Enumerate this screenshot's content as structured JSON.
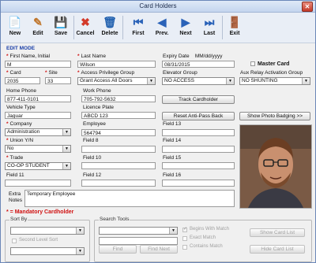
{
  "window": {
    "title": "Card Holders",
    "close_glyph": "✕"
  },
  "toolbar": [
    {
      "key": "new",
      "label": "New",
      "icon": "new-file-icon",
      "glyph": "📄",
      "color": "#2d6fb5"
    },
    {
      "key": "edit",
      "label": "Edit",
      "icon": "pencil-icon",
      "glyph": "✎",
      "color": "#c0762c"
    },
    {
      "key": "save",
      "label": "Save",
      "icon": "floppy-disk-icon",
      "glyph": "💾",
      "color": "#2f3f5f"
    },
    {
      "key": "cancel",
      "label": "Cancel",
      "icon": "cancel-icon",
      "glyph": "✖",
      "color": "#d33a2a"
    },
    {
      "key": "delete",
      "label": "Delete",
      "icon": "delete-icon",
      "glyph": "🗑",
      "color": "#1f5fae"
    },
    {
      "key": "first",
      "label": "First",
      "icon": "first-record-icon",
      "glyph": "⏮",
      "color": "#2a62b8"
    },
    {
      "key": "prev",
      "label": "Prev.",
      "icon": "previous-record-icon",
      "glyph": "◀",
      "color": "#2a62b8"
    },
    {
      "key": "next",
      "label": "Next",
      "icon": "next-record-icon",
      "glyph": "▶",
      "color": "#2a62b8"
    },
    {
      "key": "last",
      "label": "Last",
      "icon": "last-record-icon",
      "glyph": "⏭",
      "color": "#2a62b8"
    },
    {
      "key": "exit",
      "label": "Exit",
      "icon": "exit-door-icon",
      "glyph": "🚪",
      "color": "#3a8a2e"
    }
  ],
  "mode": "EDIT MODE",
  "form": {
    "first_name": {
      "label": "First Name, Initial",
      "value": "M"
    },
    "last_name": {
      "label": "Last Name",
      "value": "Wilson"
    },
    "expiry": {
      "label": "Expiry Date",
      "format": "MM/dd/yyyy",
      "value": "08/31/2015"
    },
    "master_card": {
      "label": "Master Card"
    },
    "card": {
      "label": "Card",
      "value": "2035"
    },
    "site": {
      "label": "Site",
      "value": "33"
    },
    "access_group": {
      "label": "Access Privilege Group",
      "value": "Grant Access All Doors"
    },
    "elevator_group": {
      "label": "Elevator Group",
      "value": "NO ACCESS"
    },
    "aux_relay": {
      "label": "Aux Relay Activation Group",
      "value": "NO SHUNTING"
    },
    "home_phone": {
      "label": "Home Phone",
      "value": "877-411-0101"
    },
    "work_phone": {
      "label": "Work Phone",
      "value": "705-792-5632"
    },
    "vehicle_type": {
      "label": "Vehicle Type",
      "value": "Jaguar"
    },
    "licence_plate": {
      "label": "Licence Plate",
      "value": "ABCD 123"
    },
    "company": {
      "label": "Company",
      "value": "Administration"
    },
    "employee": {
      "label": "Employee",
      "value": "564794"
    },
    "field13": {
      "label": "Field 13",
      "value": ""
    },
    "union": {
      "label": "Union Y/N",
      "value": "No"
    },
    "field8": {
      "label": "Field 8",
      "value": ""
    },
    "field14": {
      "label": "Field 14",
      "value": ""
    },
    "trade": {
      "label": "Trade",
      "value": "CO-OP STUDENT"
    },
    "field10": {
      "label": "Field 10",
      "value": ""
    },
    "field15": {
      "label": "Field 15",
      "value": ""
    },
    "field11": {
      "label": "Field 11",
      "value": ""
    },
    "field12": {
      "label": "Field 12",
      "value": ""
    },
    "field16": {
      "label": "Field 16",
      "value": ""
    },
    "extra_notes": {
      "label_line1": "Extra",
      "label_line2": "Notes",
      "value": "Temporary Employee"
    }
  },
  "buttons": {
    "track": "Track Cardholder",
    "reset_apb": "Reset Anti-Pass Back",
    "show_photo": "Show Photo Badging >>",
    "find": "Find",
    "find_next": "Find Next",
    "show_card_list": "Show Card List",
    "hide_card_list": "Hide Card List"
  },
  "mandatory_note": "* = Mandatory Cardholder",
  "sort_by": {
    "title": "Sort By",
    "second_level": "Second Level Sort"
  },
  "search_tools": {
    "title": "Search Tools",
    "begins_with": "Begins With Match",
    "exact": "Exact Match",
    "contains": "Contains Match"
  },
  "colors": {
    "accent": "#2a62b8",
    "required": "#d01010",
    "mode": "#1a3fa8"
  }
}
